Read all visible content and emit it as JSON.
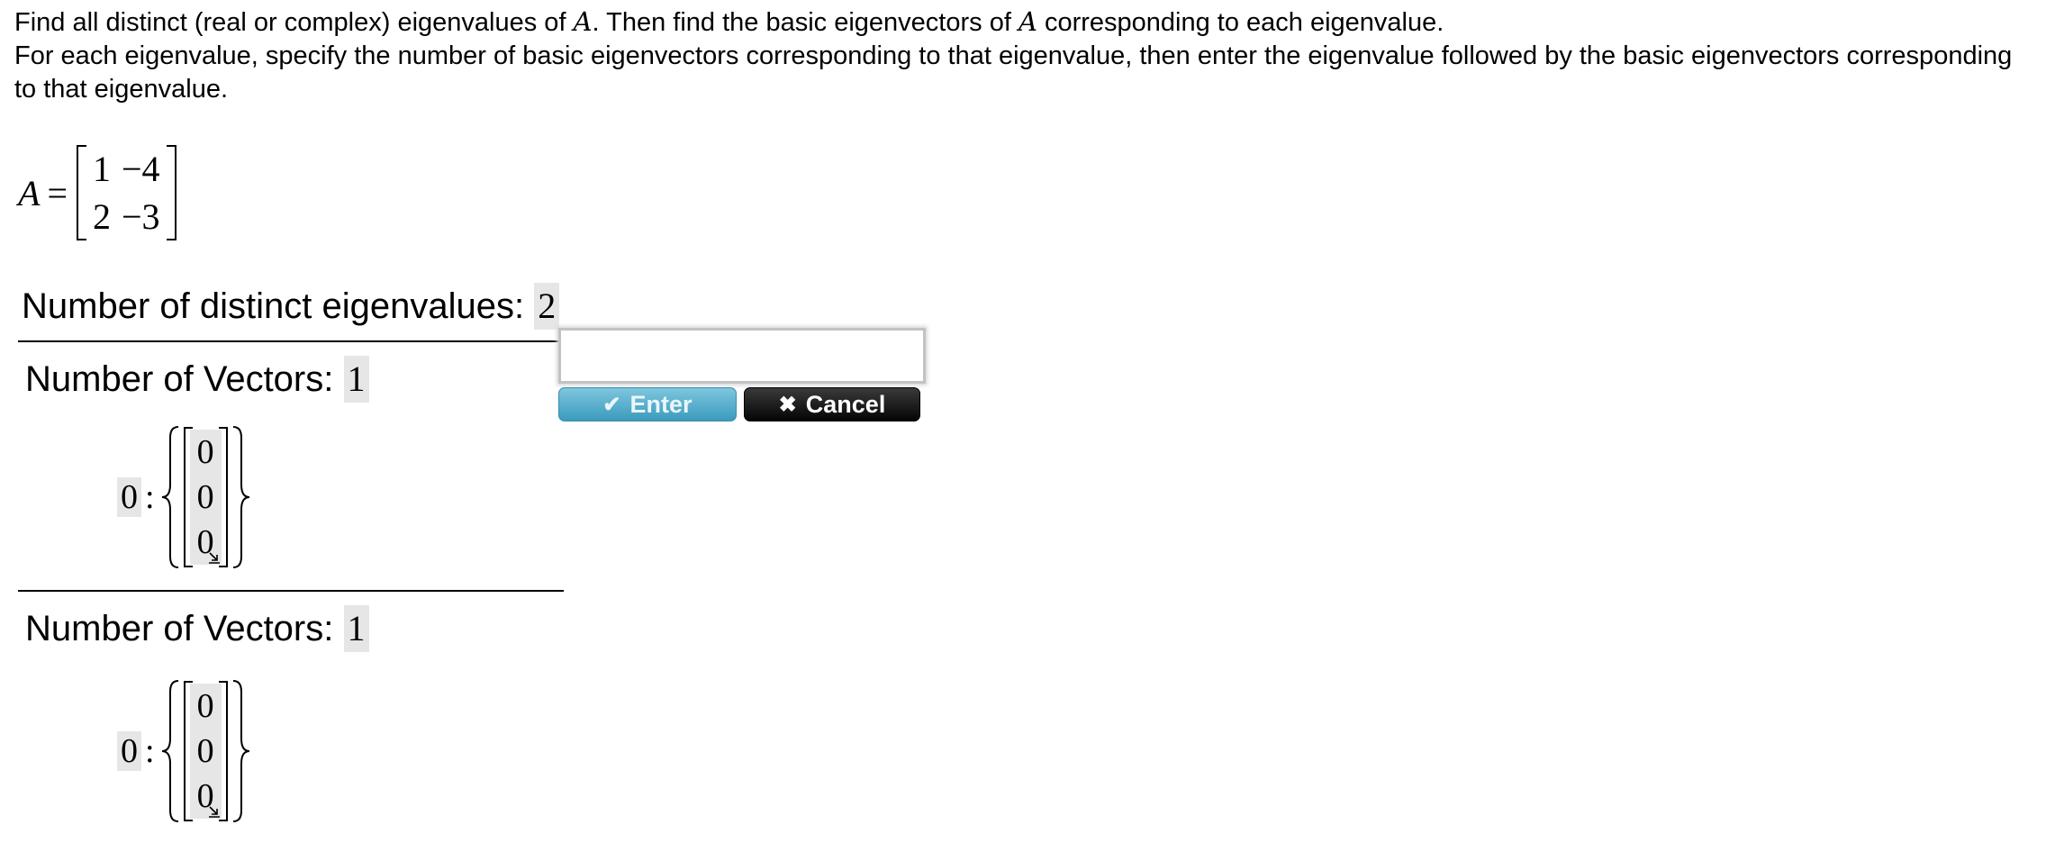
{
  "instructions": {
    "line1_a": "Find all distinct (real or complex) eigenvalues of ",
    "line1_var1": "A",
    "line1_b": ". Then find the basic eigenvectors of ",
    "line1_var2": "A",
    "line1_c": " corresponding to each eigenvalue.",
    "line2": "For each eigenvalue, specify the number of basic eigenvectors corresponding to that eigenvalue, then enter the eigenvalue followed by the basic eigenvectors corresponding to that eigenvalue."
  },
  "matrix": {
    "label": "A",
    "equals": "=",
    "rows": [
      [
        "1",
        "−4"
      ],
      [
        "2",
        "−3"
      ]
    ]
  },
  "answers": {
    "distinct_label": "Number of distinct eigenvalues:",
    "distinct_value": "2",
    "eigen_groups": [
      {
        "vectors_label": "Number of Vectors:",
        "vectors_value": "1",
        "eigenvalue": "0",
        "colon": ":",
        "vector": [
          "0",
          "0",
          "0"
        ]
      },
      {
        "vectors_label": "Number of Vectors:",
        "vectors_value": "1",
        "eigenvalue": "0",
        "colon": ":",
        "vector": [
          "0",
          "0",
          "0"
        ]
      }
    ]
  },
  "popup": {
    "input_value": "",
    "enter_label": "Enter",
    "cancel_label": "Cancel",
    "enter_icon": "checkmark-icon",
    "cancel_icon": "x-icon"
  },
  "colors": {
    "answer_bg": "#e6e6e6",
    "enter_button": "#4aa6c7",
    "cancel_button": "#000000"
  }
}
